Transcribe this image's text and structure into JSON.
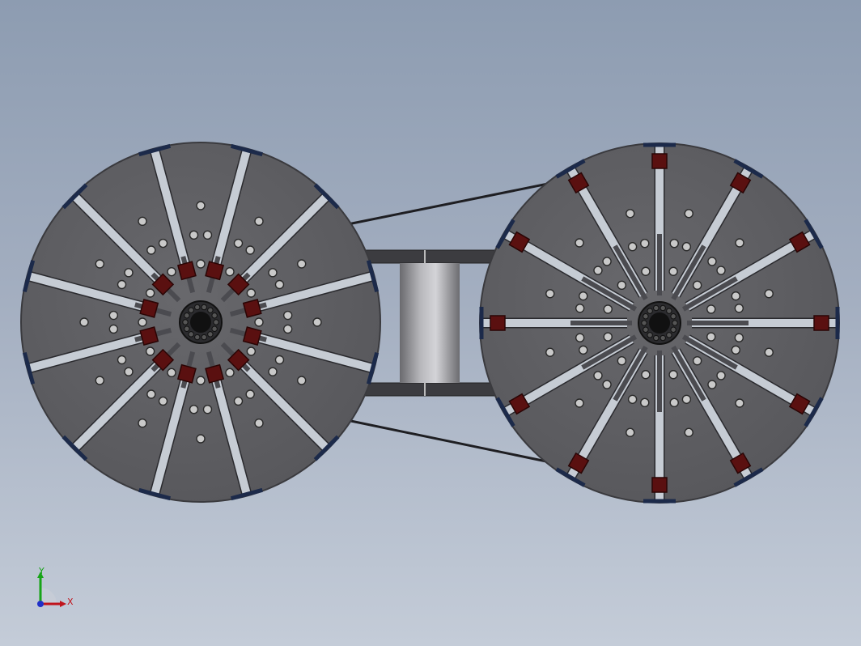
{
  "scene": {
    "background_top": "#8d9cb1",
    "background_bottom": "#c4ccd8",
    "disc_color": "#5f5f63",
    "disc_edge": "#3a3a3e",
    "spoke_color": "#c6ccd4",
    "cap_color": "#1c2a4a",
    "clamp_color": "#5a1010",
    "belt_color": "#1e1e22",
    "hole_color": "#c9c9c9",
    "hub_color": "#111111"
  },
  "assembly": {
    "left_wheel": {
      "spokes": 12,
      "clamps": 12,
      "style": "inner-clamps"
    },
    "right_wheel": {
      "spokes": 12,
      "clamps": 12,
      "style": "outer-clamps"
    }
  },
  "triad": {
    "x_label": "X",
    "y_label": "Y",
    "x_color": "#c0141c",
    "y_color": "#18a418",
    "z_color": "#2030c8"
  }
}
